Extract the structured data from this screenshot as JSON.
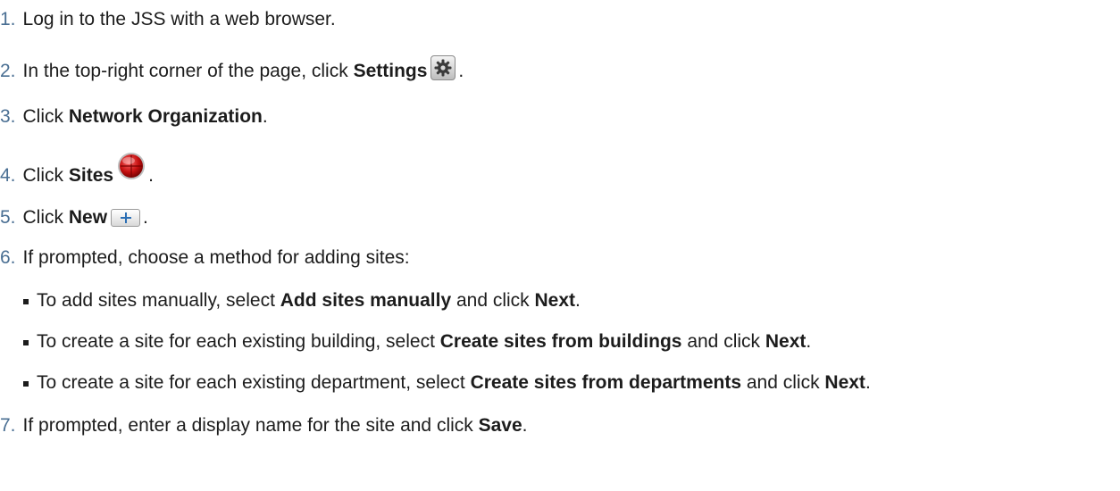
{
  "steps": [
    {
      "num": "1.",
      "pre": "Log in to the JSS with a web browser."
    },
    {
      "num": "2.",
      "pre": "In the top-right corner of the page, click ",
      "bold": "Settings",
      "post": "."
    },
    {
      "num": "3.",
      "pre": "Click ",
      "bold": "Network Organization",
      "post": "."
    },
    {
      "num": "4.",
      "pre": "Click ",
      "bold": "Sites",
      "post": "."
    },
    {
      "num": "5.",
      "pre": "Click ",
      "bold": "New",
      "post": "."
    },
    {
      "num": "6.",
      "pre": "If prompted, choose a method for adding sites:"
    },
    {
      "num": "7.",
      "pre": "If prompted, enter a display name for the site and click ",
      "bold": "Save",
      "post": "."
    }
  ],
  "substeps": [
    {
      "pre": "To add sites manually, select ",
      "bold": "Add sites manually",
      "mid": " and click ",
      "bold2": "Next",
      "post": "."
    },
    {
      "pre": "To create a site for each existing building, select ",
      "bold": "Create sites from buildings",
      "mid": " and click ",
      "bold2": "Next",
      "post": "."
    },
    {
      "pre": "To create a site for each existing department, select ",
      "bold": "Create sites from departments",
      "mid": " and click ",
      "bold2": "Next",
      "post": "."
    }
  ],
  "icons": {
    "settings": "gear-icon",
    "sites": "sites-target-icon",
    "new": "plus-icon"
  },
  "colors": {
    "step_number": "#4a6f93",
    "text": "#1c1c1c"
  }
}
